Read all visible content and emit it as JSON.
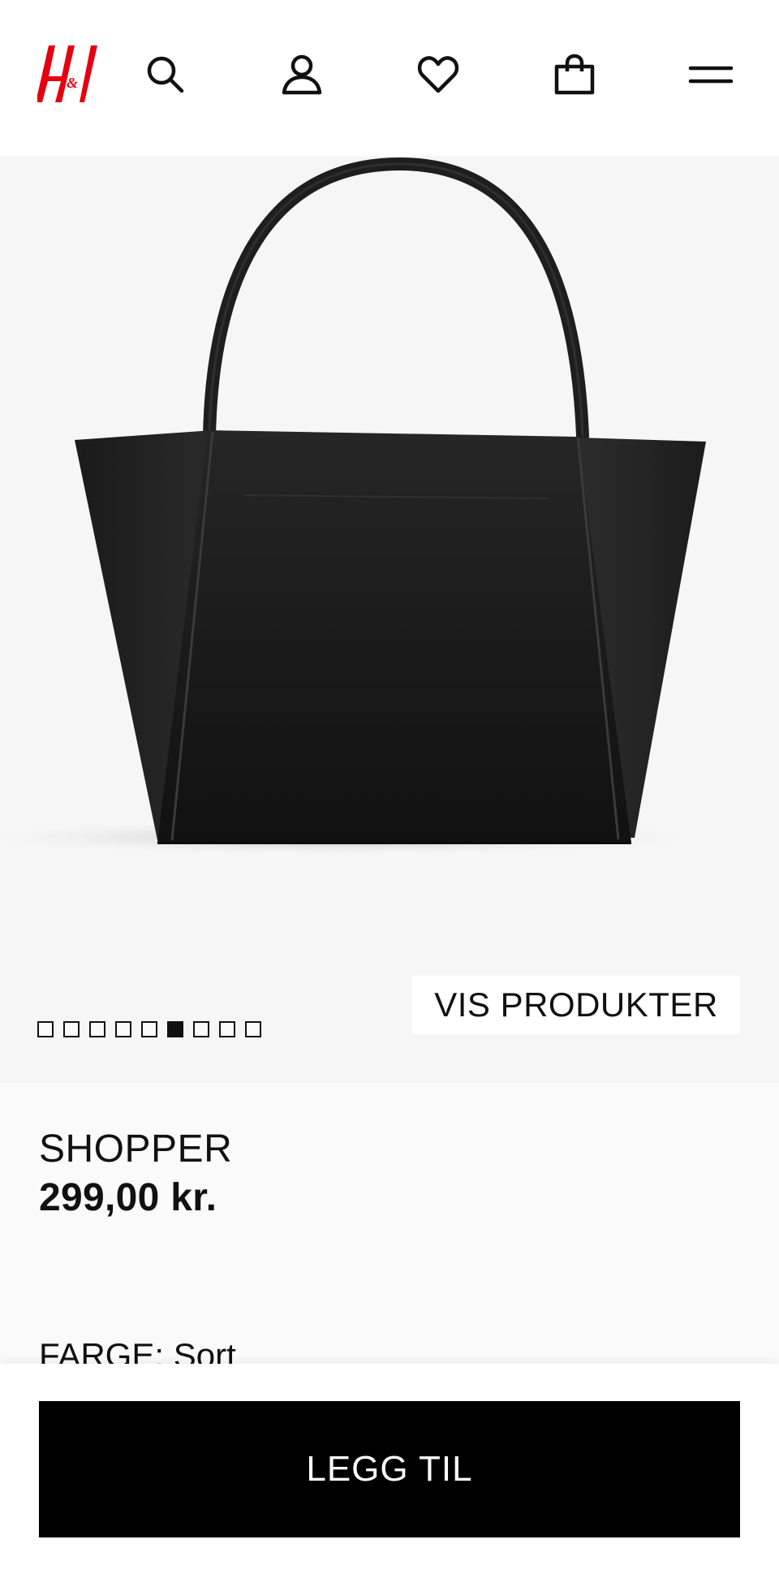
{
  "header": {
    "logo_text": "H&M",
    "icons": [
      "search-icon",
      "account-icon",
      "favorite-heart-icon",
      "shopping-bag-icon",
      "menu-icon"
    ]
  },
  "gallery": {
    "image_count": 9,
    "active_index": 5,
    "show_products_label": "VIS PRODUKTER"
  },
  "product": {
    "name": "SHOPPER",
    "price": "299,00 kr.",
    "color_label": "FARGE:",
    "color_value": "Sort"
  },
  "cta": {
    "add_label": "LEGG TIL"
  },
  "colors": {
    "brand_red": "#e50010",
    "button_black": "#000000",
    "image_bg": "#f6f6f6"
  }
}
